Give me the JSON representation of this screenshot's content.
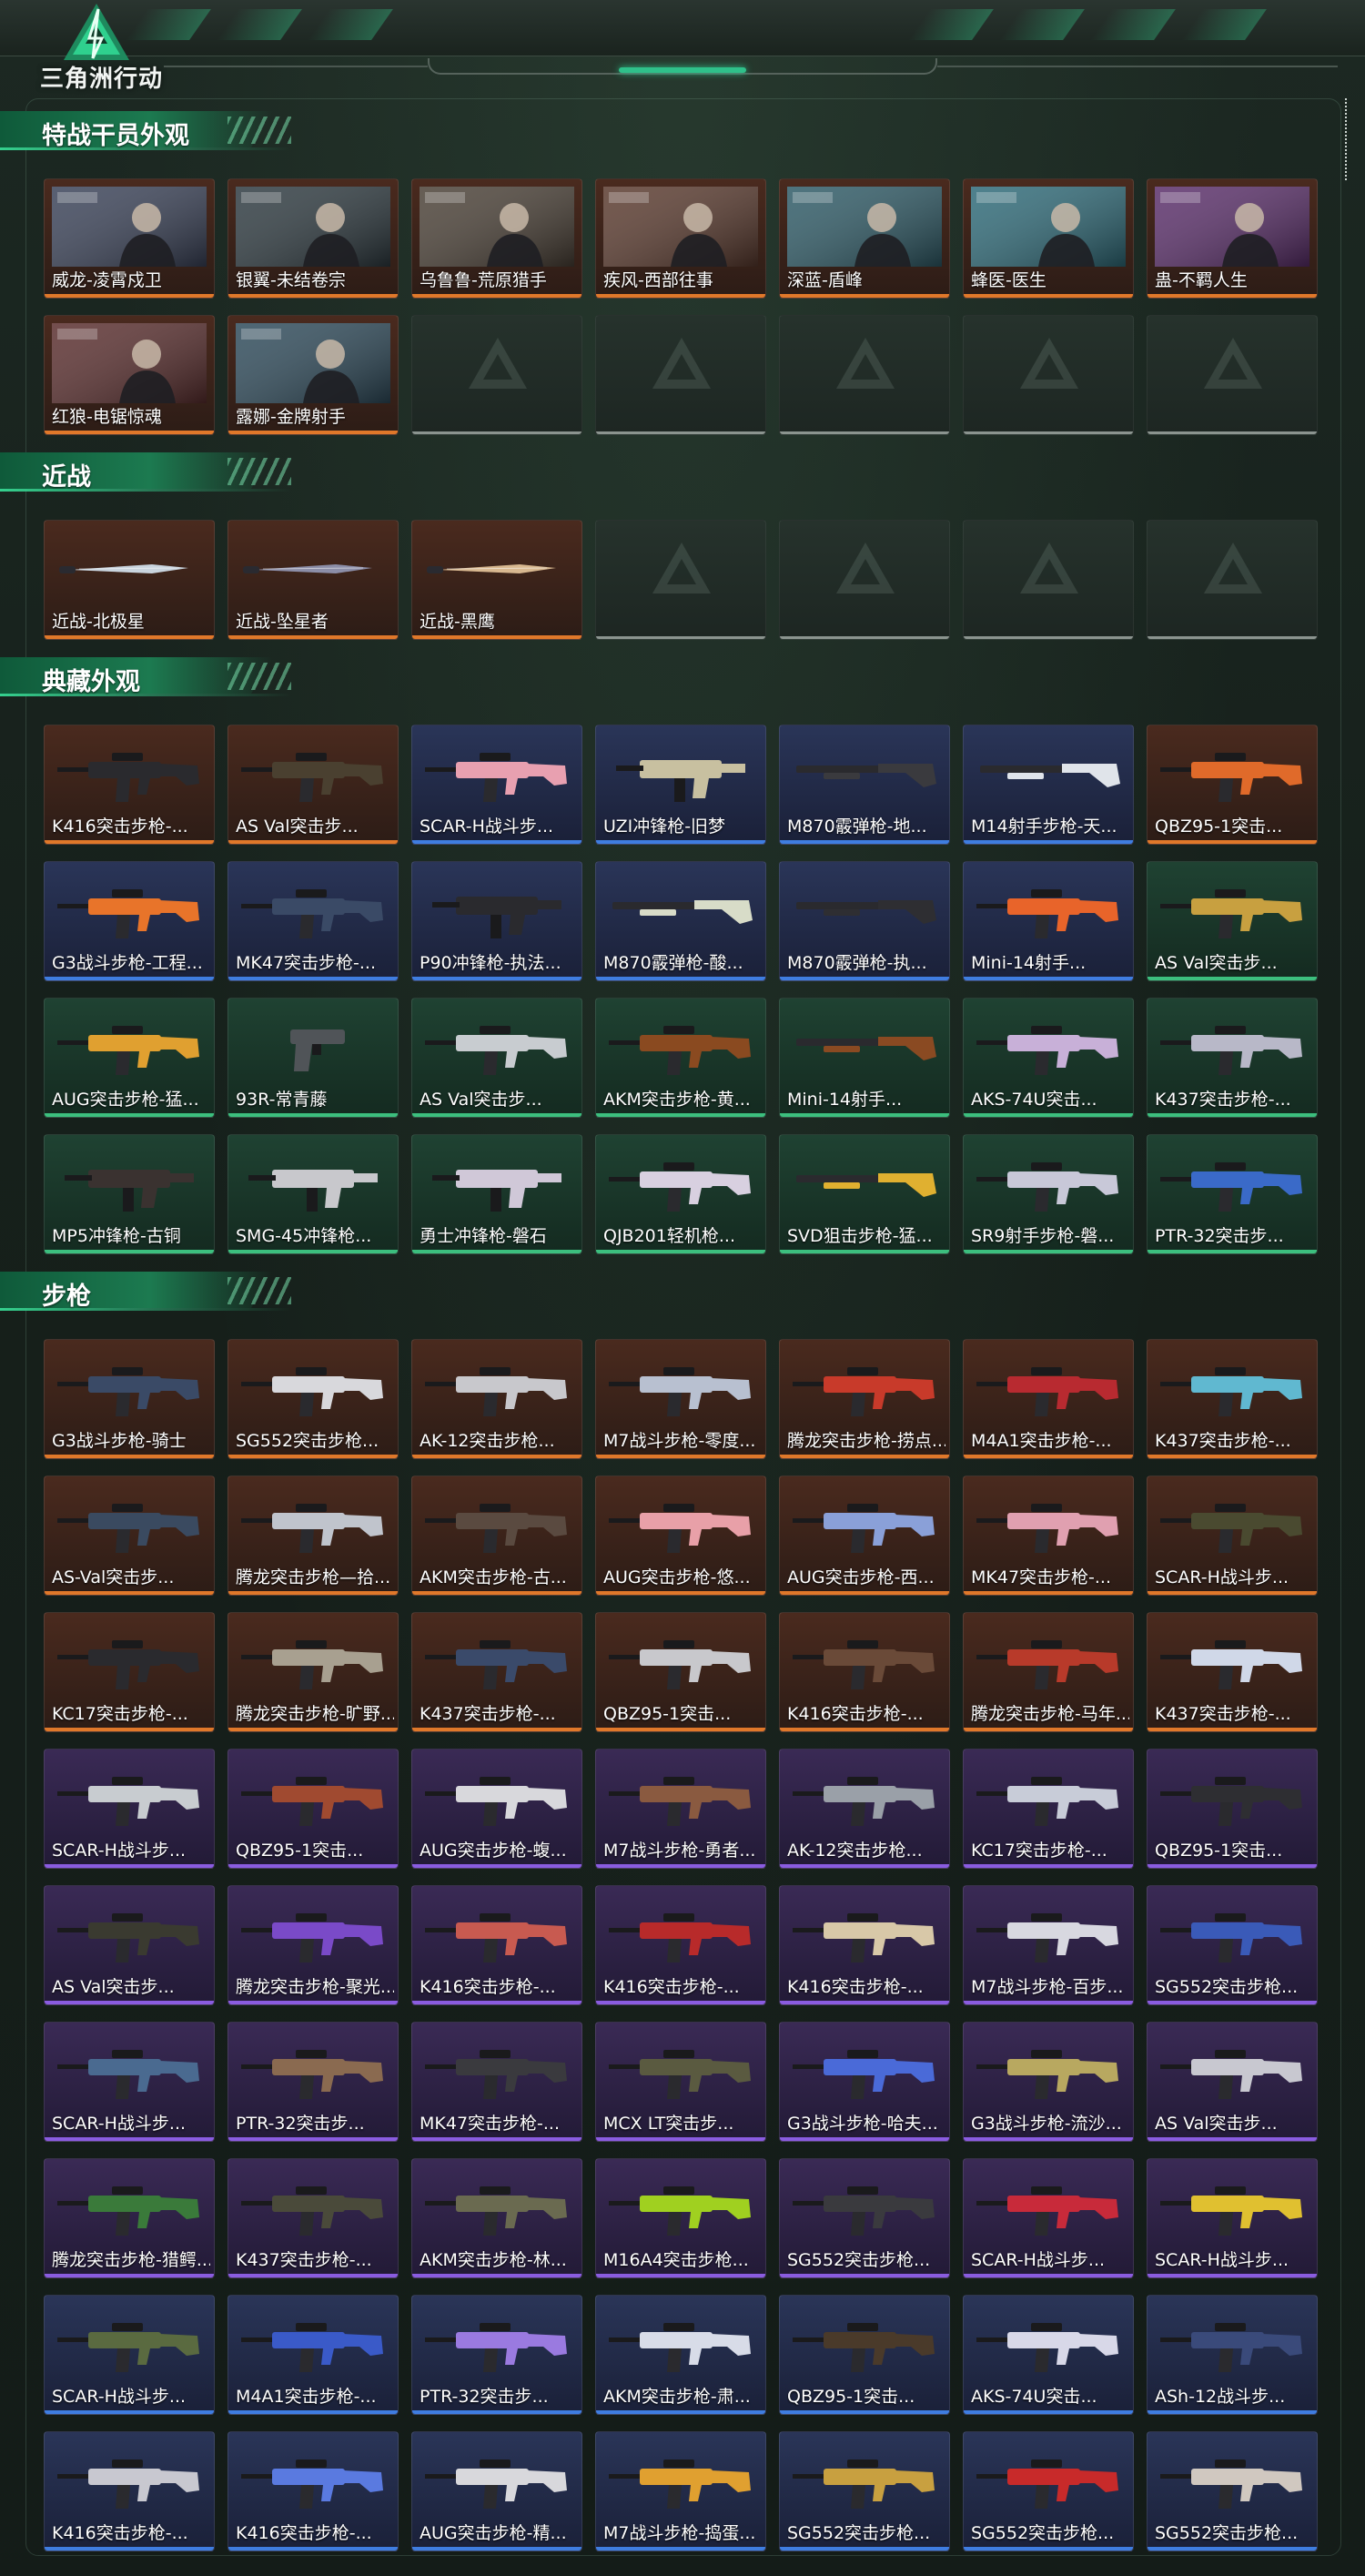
{
  "app": {
    "logo_text": "三角洲行动"
  },
  "sections": [
    {
      "title": "特战干员外观",
      "items": [
        {
          "label": "威龙-凌霄戍卫",
          "rarity": "orange",
          "kind": "portrait",
          "tone": "#3a4258"
        },
        {
          "label": "银翼-未结卷宗",
          "rarity": "orange",
          "kind": "portrait",
          "tone": "#2e3a40"
        },
        {
          "label": "乌鲁鲁-荒原猎手",
          "rarity": "orange",
          "kind": "portrait",
          "tone": "#4a4036"
        },
        {
          "label": "疾风-西部往事",
          "rarity": "orange",
          "kind": "portrait",
          "tone": "#5a3a2e"
        },
        {
          "label": "深蓝-盾峰",
          "rarity": "orange",
          "kind": "portrait",
          "tone": "#2e5a66"
        },
        {
          "label": "蜂医-医生",
          "rarity": "orange",
          "kind": "portrait",
          "tone": "#2e6a78"
        },
        {
          "label": "蛊-不羁人生",
          "rarity": "orange",
          "kind": "portrait",
          "tone": "#5a2e6a"
        },
        {
          "label": "红狼-电锯惊魂",
          "rarity": "orange",
          "kind": "portrait",
          "tone": "#5a2e2e"
        },
        {
          "label": "露娜-金牌射手",
          "rarity": "orange",
          "kind": "portrait",
          "tone": "#2e4a5a"
        },
        {
          "label": "",
          "rarity": "empty"
        },
        {
          "label": "",
          "rarity": "empty"
        },
        {
          "label": "",
          "rarity": "empty"
        },
        {
          "label": "",
          "rarity": "empty"
        },
        {
          "label": "",
          "rarity": "empty"
        }
      ]
    },
    {
      "title": "近战",
      "items": [
        {
          "label": "近战-北极星",
          "rarity": "orange",
          "kind": "knife",
          "tone": "#c9d4de"
        },
        {
          "label": "近战-坠星者",
          "rarity": "orange",
          "kind": "knife",
          "tone": "#8c8ea8"
        },
        {
          "label": "近战-黑鹰",
          "rarity": "orange",
          "kind": "knife",
          "tone": "#d8b890"
        },
        {
          "label": "",
          "rarity": "empty"
        },
        {
          "label": "",
          "rarity": "empty"
        },
        {
          "label": "",
          "rarity": "empty"
        },
        {
          "label": "",
          "rarity": "empty"
        }
      ]
    },
    {
      "title": "典藏外观",
      "items": [
        {
          "label": "K416突击步枪-...",
          "rarity": "orange",
          "kind": "rifle",
          "tone": "#2a2a2e"
        },
        {
          "label": "AS Val突击步...",
          "rarity": "orange",
          "kind": "rifle",
          "tone": "#4a4030"
        },
        {
          "label": "SCAR-H战斗步...",
          "rarity": "blue",
          "kind": "rifle",
          "tone": "#e8a0b0"
        },
        {
          "label": "UZI冲锋枪-旧梦",
          "rarity": "blue",
          "kind": "smg",
          "tone": "#c8c0a0"
        },
        {
          "label": "M870霰弹枪-地...",
          "rarity": "blue",
          "kind": "shotgun",
          "tone": "#3a3a3e"
        },
        {
          "label": "M14射手步枪-天...",
          "rarity": "blue",
          "kind": "shotgun",
          "tone": "#e0e4ea"
        },
        {
          "label": "QBZ95-1突击...",
          "rarity": "orange",
          "kind": "rifle",
          "tone": "#e06a2a"
        },
        {
          "label": "G3战斗步枪-工程...",
          "rarity": "blue",
          "kind": "rifle",
          "tone": "#e8742a"
        },
        {
          "label": "MK47突击步枪-...",
          "rarity": "blue",
          "kind": "rifle",
          "tone": "#3a4a66"
        },
        {
          "label": "P90冲锋枪-执法...",
          "rarity": "blue",
          "kind": "smg",
          "tone": "#2a2a2e"
        },
        {
          "label": "M870霰弹枪-酸...",
          "rarity": "blue",
          "kind": "shotgun",
          "tone": "#d8dcc8"
        },
        {
          "label": "M870霰弹枪-执...",
          "rarity": "blue",
          "kind": "shotgun",
          "tone": "#2e2e32"
        },
        {
          "label": "Mini-14射手...",
          "rarity": "blue",
          "kind": "rifle",
          "tone": "#e8642a"
        },
        {
          "label": "AS Val突击步...",
          "rarity": "green",
          "kind": "rifle",
          "tone": "#c8a040"
        },
        {
          "label": "AUG突击步枪-猛...",
          "rarity": "green",
          "kind": "rifle",
          "tone": "#e0a030"
        },
        {
          "label": "93R-常青藤",
          "rarity": "green",
          "kind": "pistol",
          "tone": "#505458"
        },
        {
          "label": "AS Val突击步...",
          "rarity": "green",
          "kind": "rifle",
          "tone": "#c8ccd0"
        },
        {
          "label": "AKM突击步枪-黄...",
          "rarity": "green",
          "kind": "rifle",
          "tone": "#8a4a20"
        },
        {
          "label": "Mini-14射手...",
          "rarity": "green",
          "kind": "shotgun",
          "tone": "#8a4a22"
        },
        {
          "label": "AKS-74U突击...",
          "rarity": "green",
          "kind": "rifle",
          "tone": "#c8b0d8"
        },
        {
          "label": "K437突击步枪-...",
          "rarity": "green",
          "kind": "rifle",
          "tone": "#b8b8c8"
        },
        {
          "label": "MP5冲锋枪-古铜",
          "rarity": "green",
          "kind": "smg",
          "tone": "#3a3230"
        },
        {
          "label": "SMG-45冲锋枪...",
          "rarity": "green",
          "kind": "smg",
          "tone": "#c8c8cc"
        },
        {
          "label": "勇士冲锋枪-磐石",
          "rarity": "green",
          "kind": "smg",
          "tone": "#d0c8d8"
        },
        {
          "label": "QJB201轻机枪...",
          "rarity": "green",
          "kind": "rifle",
          "tone": "#d8d0e0"
        },
        {
          "label": "SVD狙击步枪-猛...",
          "rarity": "green",
          "kind": "shotgun",
          "tone": "#e0b030"
        },
        {
          "label": "SR9射手步枪-磐...",
          "rarity": "green",
          "kind": "rifle",
          "tone": "#c8c8d8"
        },
        {
          "label": "PTR-32突击步...",
          "rarity": "green",
          "kind": "rifle",
          "tone": "#3a6ac8"
        }
      ]
    },
    {
      "title": "步枪",
      "items": [
        {
          "label": "G3战斗步枪-骑士",
          "rarity": "orange",
          "kind": "rifle",
          "tone": "#3a4a66"
        },
        {
          "label": "SG552突击步枪...",
          "rarity": "orange",
          "kind": "rifle",
          "tone": "#d8d8dc"
        },
        {
          "label": "AK-12突击步枪...",
          "rarity": "orange",
          "kind": "rifle",
          "tone": "#c8c8cc"
        },
        {
          "label": "M7战斗步枪-零度...",
          "rarity": "orange",
          "kind": "rifle",
          "tone": "#b8c0d0"
        },
        {
          "label": "腾龙突击步枪-捞点...",
          "rarity": "orange",
          "kind": "rifle",
          "tone": "#c83a2a"
        },
        {
          "label": "M4A1突击步枪-...",
          "rarity": "orange",
          "kind": "rifle",
          "tone": "#b82a30"
        },
        {
          "label": "K437突击步枪-...",
          "rarity": "orange",
          "kind": "rifle",
          "tone": "#60b8d0"
        },
        {
          "label": "AS-Val突击步...",
          "rarity": "orange",
          "kind": "rifle",
          "tone": "#3a4a60"
        },
        {
          "label": "腾龙突击步枪—拾...",
          "rarity": "orange",
          "kind": "rifle",
          "tone": "#c0c4cc"
        },
        {
          "label": "AKM突击步枪-古...",
          "rarity": "orange",
          "kind": "rifle",
          "tone": "#5a4a40"
        },
        {
          "label": "AUG突击步枪-悠...",
          "rarity": "orange",
          "kind": "rifle",
          "tone": "#e8a0a8"
        },
        {
          "label": "AUG突击步枪-西...",
          "rarity": "orange",
          "kind": "rifle",
          "tone": "#8aa0d8"
        },
        {
          "label": "MK47突击步枪-...",
          "rarity": "orange",
          "kind": "rifle",
          "tone": "#e0a0b0"
        },
        {
          "label": "SCAR-H战斗步...",
          "rarity": "orange",
          "kind": "rifle",
          "tone": "#4a4a30"
        },
        {
          "label": "KC17突击步枪-...",
          "rarity": "orange",
          "kind": "rifle",
          "tone": "#2a2a2e"
        },
        {
          "label": "腾龙突击步枪-旷野...",
          "rarity": "orange",
          "kind": "rifle",
          "tone": "#a8a090"
        },
        {
          "label": "K437突击步枪-...",
          "rarity": "orange",
          "kind": "rifle",
          "tone": "#3a4a6a"
        },
        {
          "label": "QBZ95-1突击...",
          "rarity": "orange",
          "kind": "rifle",
          "tone": "#c8c8cc"
        },
        {
          "label": "K416突击步枪-...",
          "rarity": "orange",
          "kind": "rifle",
          "tone": "#6a4a38"
        },
        {
          "label": "腾龙突击步枪-马年...",
          "rarity": "orange",
          "kind": "rifle",
          "tone": "#b83a2a"
        },
        {
          "label": "K437突击步枪-...",
          "rarity": "orange",
          "kind": "rifle",
          "tone": "#d0d8e8"
        },
        {
          "label": "SCAR-H战斗步...",
          "rarity": "purple",
          "kind": "rifle",
          "tone": "#c8ccd0"
        },
        {
          "label": "QBZ95-1突击...",
          "rarity": "purple",
          "kind": "rifle",
          "tone": "#a04a30"
        },
        {
          "label": "AUG突击步枪-蝮...",
          "rarity": "purple",
          "kind": "rifle",
          "tone": "#d8d8dc"
        },
        {
          "label": "M7战斗步枪-勇者...",
          "rarity": "purple",
          "kind": "rifle",
          "tone": "#8a5a40"
        },
        {
          "label": "AK-12突击步枪...",
          "rarity": "purple",
          "kind": "rifle",
          "tone": "#9aa0a8"
        },
        {
          "label": "KC17突击步枪-...",
          "rarity": "purple",
          "kind": "rifle",
          "tone": "#c8ccd8"
        },
        {
          "label": "QBZ95-1突击...",
          "rarity": "purple",
          "kind": "rifle",
          "tone": "#2e2e32"
        },
        {
          "label": "AS Val突击步...",
          "rarity": "purple",
          "kind": "rifle",
          "tone": "#3a3a30"
        },
        {
          "label": "腾龙突击步枪-聚光...",
          "rarity": "purple",
          "kind": "rifle",
          "tone": "#7a4ac8"
        },
        {
          "label": "K416突击步枪-...",
          "rarity": "purple",
          "kind": "rifle",
          "tone": "#c85a50"
        },
        {
          "label": "K416突击步枪-...",
          "rarity": "purple",
          "kind": "rifle",
          "tone": "#b82a2a"
        },
        {
          "label": "K416突击步枪-...",
          "rarity": "purple",
          "kind": "rifle",
          "tone": "#d8c8a8"
        },
        {
          "label": "M7战斗步枪-百步...",
          "rarity": "purple",
          "kind": "rifle",
          "tone": "#d8d8e0"
        },
        {
          "label": "SG552突击步枪...",
          "rarity": "purple",
          "kind": "rifle",
          "tone": "#3a5ab8"
        },
        {
          "label": "SCAR-H战斗步...",
          "rarity": "purple",
          "kind": "rifle",
          "tone": "#4a6a90"
        },
        {
          "label": "PTR-32突击步...",
          "rarity": "purple",
          "kind": "rifle",
          "tone": "#8a6a50"
        },
        {
          "label": "MK47突击步枪-...",
          "rarity": "purple",
          "kind": "rifle",
          "tone": "#3a3a3e"
        },
        {
          "label": "MCX LT突击步...",
          "rarity": "purple",
          "kind": "rifle",
          "tone": "#5a5a40"
        },
        {
          "label": "G3战斗步枪-哈夫...",
          "rarity": "purple",
          "kind": "rifle",
          "tone": "#4a6ad8"
        },
        {
          "label": "G3战斗步枪-流沙...",
          "rarity": "purple",
          "kind": "rifle",
          "tone": "#b8a860"
        },
        {
          "label": "AS Val突击步...",
          "rarity": "purple",
          "kind": "rifle",
          "tone": "#c8c8d0"
        },
        {
          "label": "腾龙突击步枪-猎鳄...",
          "rarity": "purple",
          "kind": "rifle",
          "tone": "#3a7a3a"
        },
        {
          "label": "K437突击步枪-...",
          "rarity": "purple",
          "kind": "rifle",
          "tone": "#4a4a3a"
        },
        {
          "label": "AKM突击步枪-林...",
          "rarity": "purple",
          "kind": "rifle",
          "tone": "#6a6a50"
        },
        {
          "label": "M16A4突击步枪...",
          "rarity": "purple",
          "kind": "rifle",
          "tone": "#a0d020"
        },
        {
          "label": "SG552突击步枪...",
          "rarity": "purple",
          "kind": "rifle",
          "tone": "#3a3a3e"
        },
        {
          "label": "SCAR-H战斗步...",
          "rarity": "purple",
          "kind": "rifle",
          "tone": "#c82a3a"
        },
        {
          "label": "SCAR-H战斗步...",
          "rarity": "purple",
          "kind": "rifle",
          "tone": "#e0c030"
        },
        {
          "label": "SCAR-H战斗步...",
          "rarity": "blue",
          "kind": "rifle",
          "tone": "#5a6a40"
        },
        {
          "label": "M4A1突击步枪-...",
          "rarity": "blue",
          "kind": "rifle",
          "tone": "#3a5ac8"
        },
        {
          "label": "PTR-32突击步...",
          "rarity": "blue",
          "kind": "rifle",
          "tone": "#9a7ae0"
        },
        {
          "label": "AKM突击步枪-肃...",
          "rarity": "blue",
          "kind": "rifle",
          "tone": "#d8dce8"
        },
        {
          "label": "QBZ95-1突击...",
          "rarity": "blue",
          "kind": "rifle",
          "tone": "#4a3a2a"
        },
        {
          "label": "AKS-74U突击...",
          "rarity": "blue",
          "kind": "rifle",
          "tone": "#d8d8e8"
        },
        {
          "label": "ASh-12战斗步...",
          "rarity": "blue",
          "kind": "rifle",
          "tone": "#3a4a7a"
        },
        {
          "label": "K416突击步枪-...",
          "rarity": "blue",
          "kind": "rifle",
          "tone": "#c8c8d0"
        },
        {
          "label": "K416突击步枪-...",
          "rarity": "blue",
          "kind": "rifle",
          "tone": "#5a7ae0"
        },
        {
          "label": "AUG突击步枪-精...",
          "rarity": "blue",
          "kind": "rifle",
          "tone": "#d8d8dc"
        },
        {
          "label": "M7战斗步枪-捣蛋...",
          "rarity": "blue",
          "kind": "rifle",
          "tone": "#e0a030"
        },
        {
          "label": "SG552突击步枪...",
          "rarity": "blue",
          "kind": "rifle",
          "tone": "#c8a040"
        },
        {
          "label": "SG552突击步枪...",
          "rarity": "blue",
          "kind": "rifle",
          "tone": "#c82a2a"
        },
        {
          "label": "SG552突击步枪...",
          "rarity": "blue",
          "kind": "rifle",
          "tone": "#d0c8c0"
        }
      ]
    }
  ]
}
